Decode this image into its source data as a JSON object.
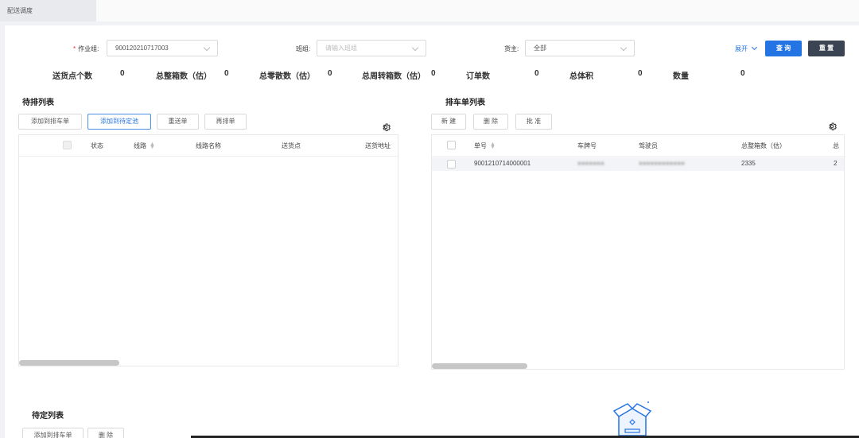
{
  "tabs": {
    "active": "配送调度"
  },
  "filters": {
    "work_group": {
      "label": "作业组:",
      "value": "900120210717003"
    },
    "shift": {
      "label": "班组:",
      "placeholder": "请输入班组"
    },
    "owner": {
      "label": "货主:",
      "value": "全部"
    },
    "expand": "展开",
    "query": "查 询",
    "reset": "重 置"
  },
  "stats": [
    {
      "label": "送货点个数",
      "value": "0"
    },
    {
      "label": "总整箱数（估）",
      "value": "0"
    },
    {
      "label": "总零散数（估）",
      "value": "0"
    },
    {
      "label": "总周转箱数（估）",
      "value": "0"
    },
    {
      "label": "订单数",
      "value": "0"
    },
    {
      "label": "总体积",
      "value": "0"
    },
    {
      "label": "数量",
      "value": "0"
    }
  ],
  "pending": {
    "title": "待排列表",
    "buttons": [
      "添加到排车单",
      "添加到待定池",
      "重送单",
      "再排单"
    ],
    "columns": [
      "状态",
      "线路",
      "线路名称",
      "送货点",
      "送货地址"
    ]
  },
  "schedule": {
    "title": "排车单列表",
    "buttons": [
      "新 建",
      "删 除",
      "批 准"
    ],
    "columns": [
      "单号",
      "车牌号",
      "驾驶员",
      "总整箱数（估）",
      "总"
    ],
    "rows": [
      {
        "id": "9001210714000001",
        "plate": "(blurred)",
        "driver": "(blurred)",
        "boxes": "2335",
        "extra": "2"
      }
    ]
  },
  "tbd": {
    "title": "待定列表",
    "buttons": [
      "添加到排车单",
      "删 除"
    ]
  },
  "colors": {
    "primary": "#2474e3",
    "dark": "#3b4452",
    "required": "#f5222d"
  }
}
